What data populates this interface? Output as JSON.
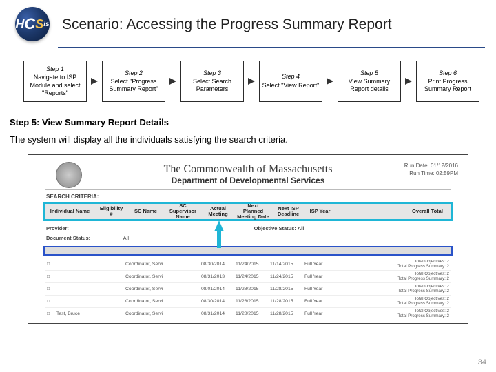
{
  "logo": {
    "text": "HCSis"
  },
  "title": "Scenario: Accessing the Progress Summary Report",
  "steps": [
    {
      "title": "Step 1",
      "body": "Navigate to ISP Module and select \"Reports\""
    },
    {
      "title": "Step 2",
      "body": "Select \"Progress Summary Report\""
    },
    {
      "title": "Step 3",
      "body": "Select Search Parameters"
    },
    {
      "title": "Step 4",
      "body": "Select \"View Report\""
    },
    {
      "title": "Step 5",
      "body": "View Summary Report details"
    },
    {
      "title": "Step 6",
      "body": "Print Progress Summary Report"
    }
  ],
  "section_title": "Step 5: View Summary Report Details",
  "body_text": "The system will display all the individuals satisfying the search criteria.",
  "report": {
    "title1": "The Commonwealth of Massachusetts",
    "title2": "Department of Developmental Services",
    "run_date_label": "Run Date: 01/12/2016",
    "run_time_label": "Run Time: 02:59PM",
    "search_label": "SEARCH CRITERIA:",
    "headers": {
      "c1": "Individual Name",
      "c2": "Eligibility #",
      "c3": "SC Name",
      "c4": "SC Supervisor Name",
      "c5": "Actual Meeting",
      "c6": "Next Planned Meeting Date",
      "c7": "Next ISP Deadline",
      "c8": "ISP Year",
      "c9": "Overall Total"
    },
    "provider_label": "Provider:",
    "objective_label": "Objective Status:",
    "objective_value": "All",
    "doc_status_label": "Document Status:",
    "doc_status_value": "All",
    "rows": [
      {
        "name": "",
        "elig": "",
        "sc": "Coordinator, Service",
        "sup": "",
        "d1": "08/30/2014",
        "d2": "11/24/2015",
        "d3": "11/14/2015",
        "yr": "Full Year",
        "tot": "Total Objectives: 2\nTotal Progress Summary: 2"
      },
      {
        "name": "",
        "elig": "",
        "sc": "Coordinator, Service",
        "sup": "",
        "d1": "08/31/2013",
        "d2": "11/24/2015",
        "d3": "11/24/2015",
        "yr": "Full Year",
        "tot": "Total Objectives: 2\nTotal Progress Summary: 2"
      },
      {
        "name": "",
        "elig": "",
        "sc": "Coordinator, Service",
        "sup": "",
        "d1": "08/01/2014",
        "d2": "11/28/2015",
        "d3": "11/28/2015",
        "yr": "Full Year",
        "tot": "Total Objectives: 2\nTotal Progress Summary: 2"
      },
      {
        "name": "",
        "elig": "",
        "sc": "Coordinator, Service",
        "sup": "",
        "d1": "08/30/2014",
        "d2": "11/28/2015",
        "d3": "11/28/2015",
        "yr": "Full Year",
        "tot": "Total Objectives: 2\nTotal Progress Summary: 2"
      },
      {
        "name": "Test, Bruce",
        "elig": "",
        "sc": "Coordinator, Service",
        "sup": "",
        "d1": "08/31/2014",
        "d2": "11/28/2015",
        "d3": "11/28/2015",
        "yr": "Full Year",
        "tot": "Total Objectives: 2\nTotal Progress Summary: 2"
      }
    ]
  },
  "page_number": "34"
}
